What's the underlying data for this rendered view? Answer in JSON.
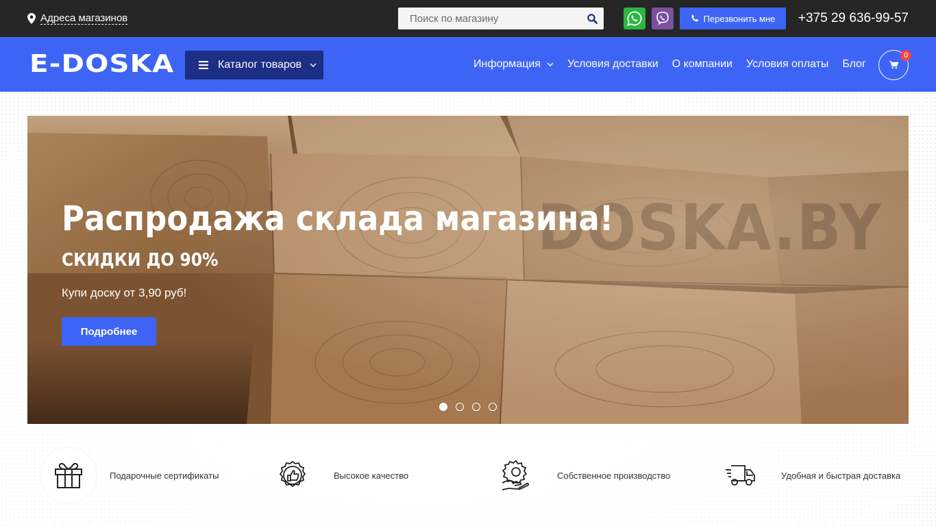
{
  "topbar": {
    "stores_link": "Адреса магазинов",
    "search_placeholder": "Поиск по магазину",
    "callback_label": "Перезвонить мне",
    "phone": "+375 29 636-99-57"
  },
  "nav": {
    "logo": "E-DOSKA",
    "catalog_label": "Каталог товаров",
    "menu": [
      {
        "label": "Информация"
      },
      {
        "label": "Условия доставки"
      },
      {
        "label": "О компании"
      },
      {
        "label": "Условия оплаты"
      },
      {
        "label": "Блог"
      }
    ],
    "cart_count": "0"
  },
  "hero": {
    "title": "Распродажа склада магазина!",
    "subtitle": "СКИДКИ ДО 90%",
    "text": "Купи доску от 3,90 руб!",
    "button": "Подробнее",
    "watermark": "DOSKA.BY",
    "slides_total": 4,
    "active_slide": 1
  },
  "features": [
    {
      "label": "Подарочные сертификаты",
      "icon": "gift-icon"
    },
    {
      "label": "Высокое качество",
      "icon": "quality-badge-icon"
    },
    {
      "label": "Собственное производство",
      "icon": "production-gear-icon"
    },
    {
      "label": "Удобная и быстрая доставка",
      "icon": "delivery-truck-icon"
    }
  ],
  "colors": {
    "topbar_bg": "#262626",
    "brand_blue": "#3d64f4",
    "catalog_bg": "#1d2e85",
    "whatsapp": "#2bb741",
    "viber": "#7b519d",
    "badge": "#f34545"
  }
}
